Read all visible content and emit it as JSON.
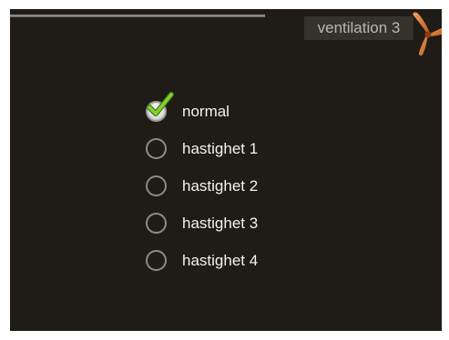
{
  "header": {
    "title": "ventilation 3",
    "icon": "fan-icon"
  },
  "colors": {
    "screen_bg": "#1f1b17",
    "title_bg": "#35312d",
    "title_text": "#b9b6b2",
    "fan_accent": "#d9772f",
    "check_green": "#79c72a"
  },
  "options": [
    {
      "label": "normal",
      "selected": true
    },
    {
      "label": "hastighet 1",
      "selected": false
    },
    {
      "label": "hastighet 2",
      "selected": false
    },
    {
      "label": "hastighet 3",
      "selected": false
    },
    {
      "label": "hastighet 4",
      "selected": false
    }
  ]
}
